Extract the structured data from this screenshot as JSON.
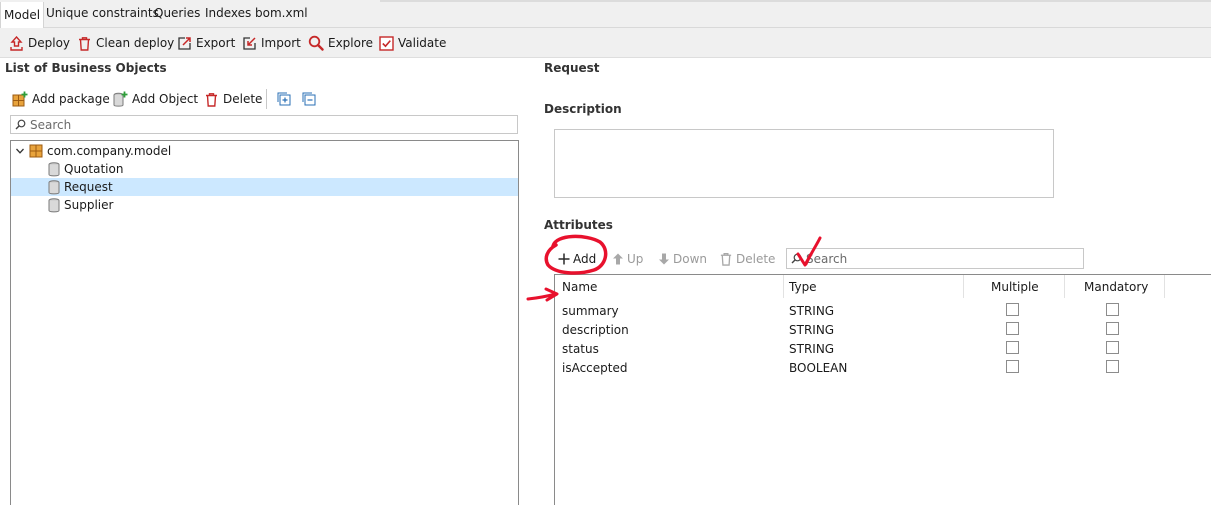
{
  "tabs": [
    "Model",
    "Unique constraints",
    "Queries",
    "Indexes",
    "bom.xml"
  ],
  "toolbar": {
    "deploy": "Deploy",
    "clean_deploy": "Clean deploy",
    "export": "Export",
    "import": "Import",
    "explore": "Explore",
    "validate": "Validate"
  },
  "left": {
    "title": "List of Business Objects",
    "add_package": "Add package",
    "add_object": "Add Object",
    "delete": "Delete",
    "search_placeholder": "Search",
    "tree": {
      "package": "com.company.model",
      "objects": [
        "Quotation",
        "Request",
        "Supplier"
      ],
      "selected": "Request"
    }
  },
  "right": {
    "object_name": "Request",
    "description_label": "Description",
    "description_value": "",
    "attributes_label": "Attributes",
    "add": "Add",
    "up": "Up",
    "down": "Down",
    "delete": "Delete",
    "search_placeholder": "Search",
    "columns": [
      "Name",
      "Type",
      "Multiple",
      "Mandatory"
    ],
    "rows": [
      {
        "name": "summary",
        "type": "STRING",
        "multiple": false,
        "mandatory": false
      },
      {
        "name": "description",
        "type": "STRING",
        "multiple": false,
        "mandatory": false
      },
      {
        "name": "status",
        "type": "STRING",
        "multiple": false,
        "mandatory": false
      },
      {
        "name": "isAccepted",
        "type": "BOOLEAN",
        "multiple": false,
        "mandatory": false
      }
    ]
  },
  "colors": {
    "selection": "#cce8ff",
    "annotation_red": "#e8112d",
    "icon_red": "#c62828",
    "icon_blue": "#2a6fb5"
  }
}
